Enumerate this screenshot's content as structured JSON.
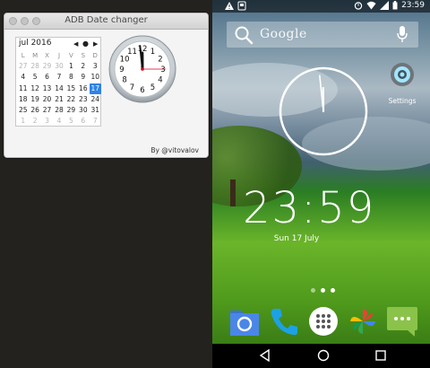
{
  "app_window": {
    "title": "ADB Date changer",
    "credit": "By @vitovalov"
  },
  "calendar": {
    "month_label": "jul 2016",
    "nav_prev": "◀",
    "nav_today": "●",
    "nav_next": "▶",
    "weekday_headers": [
      "L",
      "M",
      "X",
      "J",
      "V",
      "S",
      "D"
    ],
    "weeks": [
      [
        "27",
        "28",
        "29",
        "30",
        "1",
        "2",
        "3"
      ],
      [
        "4",
        "5",
        "6",
        "7",
        "8",
        "9",
        "10"
      ],
      [
        "11",
        "12",
        "13",
        "14",
        "15",
        "16",
        "17"
      ],
      [
        "18",
        "19",
        "20",
        "21",
        "22",
        "23",
        "24"
      ],
      [
        "25",
        "26",
        "27",
        "28",
        "29",
        "30",
        "31"
      ],
      [
        "1",
        "2",
        "3",
        "4",
        "5",
        "6",
        "7"
      ]
    ],
    "selected_day": "17"
  },
  "mac_clock": {
    "numbers": [
      "12",
      "1",
      "2",
      "3",
      "4",
      "5",
      "6",
      "7",
      "8",
      "9",
      "10",
      "11"
    ],
    "hour": 23,
    "minute": 59,
    "second": 15
  },
  "android": {
    "status": {
      "time": "23:59"
    },
    "search": {
      "brand": "Google"
    },
    "settings_label": "Settings",
    "digital_clock": "23:59",
    "date": "Sun 17 July",
    "colors": {
      "accent": "#2e83e6",
      "phone": "#1da1e6",
      "messaging": "#8bc34a"
    }
  }
}
